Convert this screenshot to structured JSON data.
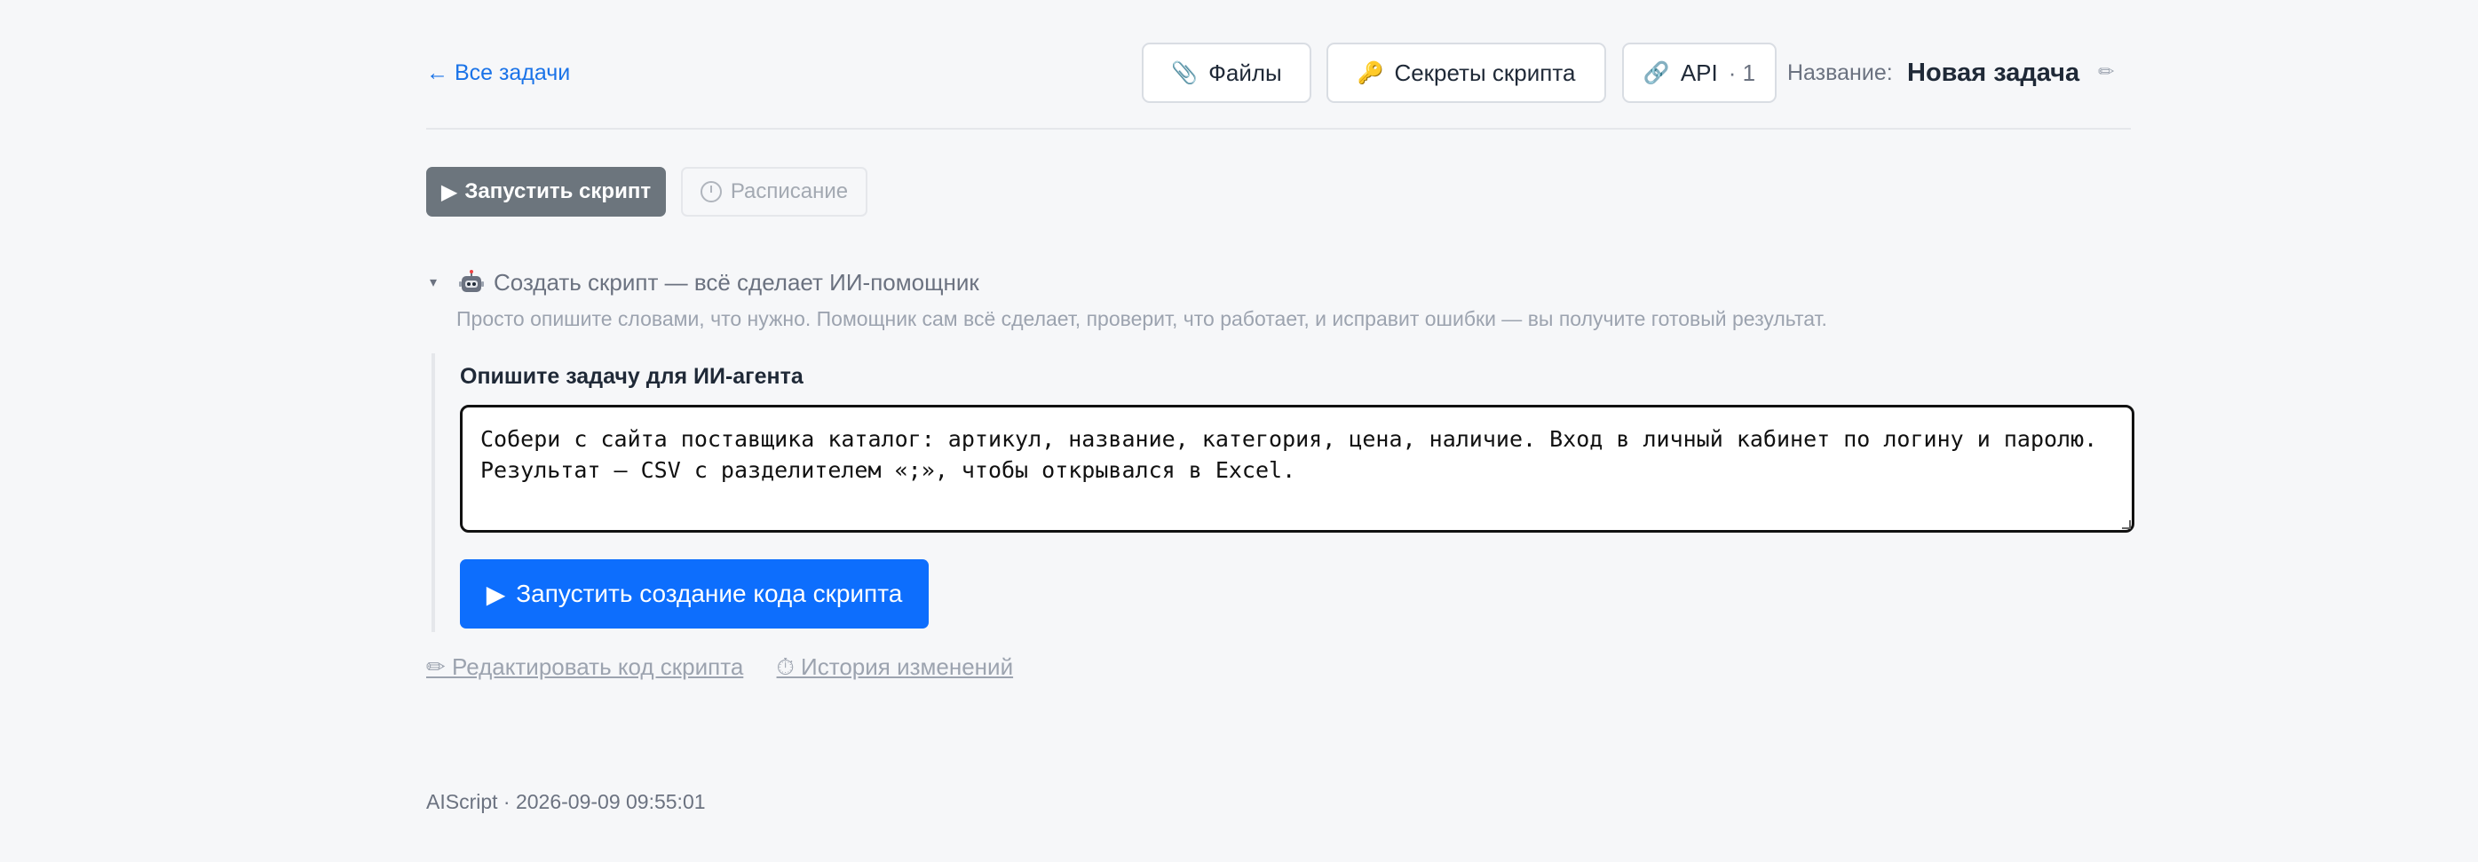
{
  "header": {
    "back_link": "← Все задачи",
    "files_icon": "📎",
    "files_label": "Файлы",
    "secrets_icon": "🔑",
    "secrets_label": "Секреты скрипта",
    "api_icon": "🔗",
    "api_label": "API",
    "api_count": "· 1",
    "name_label": "Название:",
    "name_value": "Новая задача",
    "edit_icon": "✏"
  },
  "toolbar": {
    "run_icon": "▶",
    "run_label": "Запустить скрипт",
    "schedule_label": "Расписание"
  },
  "section": {
    "caret": "▾",
    "title": "Создать скрипт — всё сделает ИИ-помощник",
    "description": "Просто опишите словами, что нужно. Помощник сам всё сделает, проверит, что работает, и исправит ошибки — вы получите готовый результат.",
    "task_label": "Опишите задачу для ИИ-агента",
    "task_value": "Собери с сайта поставщика каталог: артикул, название, категория, цена, наличие. Вход в личный кабинет по логину и паролю. Результат — CSV с разделителем «;», чтобы открывался в Excel.",
    "generate_icon": "▶",
    "generate_label": "Запустить создание кода скрипта"
  },
  "links": {
    "edit_code": "✏ Редактировать код скрипта",
    "history": "⏱ История изменений"
  },
  "footer": {
    "text": "AIScript · 2026-09-09 09:55:01"
  },
  "colors": {
    "accent": "#0d6efd",
    "link": "#1a73e8",
    "run_button": "#6c757d",
    "background": "#f6f7f9"
  }
}
